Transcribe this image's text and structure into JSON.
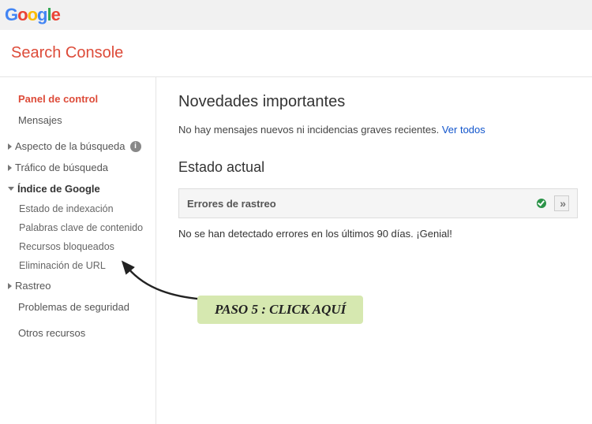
{
  "logo": {
    "g1": "G",
    "g2": "o",
    "g3": "o",
    "g4": "g",
    "g5": "l",
    "g6": "e"
  },
  "app_title": "Search Console",
  "sidebar": {
    "panel": "Panel de control",
    "messages": "Mensajes",
    "search_appearance": "Aspecto de la búsqueda",
    "search_traffic": "Tráfico de búsqueda",
    "google_index": "Índice de Google",
    "index_status": "Estado de indexación",
    "content_keywords": "Palabras clave de contenido",
    "blocked_resources": "Recursos bloqueados",
    "url_removal": "Eliminación de URL",
    "crawl": "Rastreo",
    "security": "Problemas de seguridad",
    "other": "Otros recursos",
    "info_glyph": "i"
  },
  "main": {
    "heading": "Novedades importantes",
    "no_messages": "No hay mensajes nuevos ni incidencias graves recientes. ",
    "view_all": "Ver todos",
    "status_heading": "Estado actual",
    "crawl_errors": "Errores de rastreo",
    "chevron": "»",
    "status_ok": "No se han detectado errores en los últimos 90 días. ¡Genial!"
  },
  "annotation": "PASO 5 : CLICK AQUÍ"
}
